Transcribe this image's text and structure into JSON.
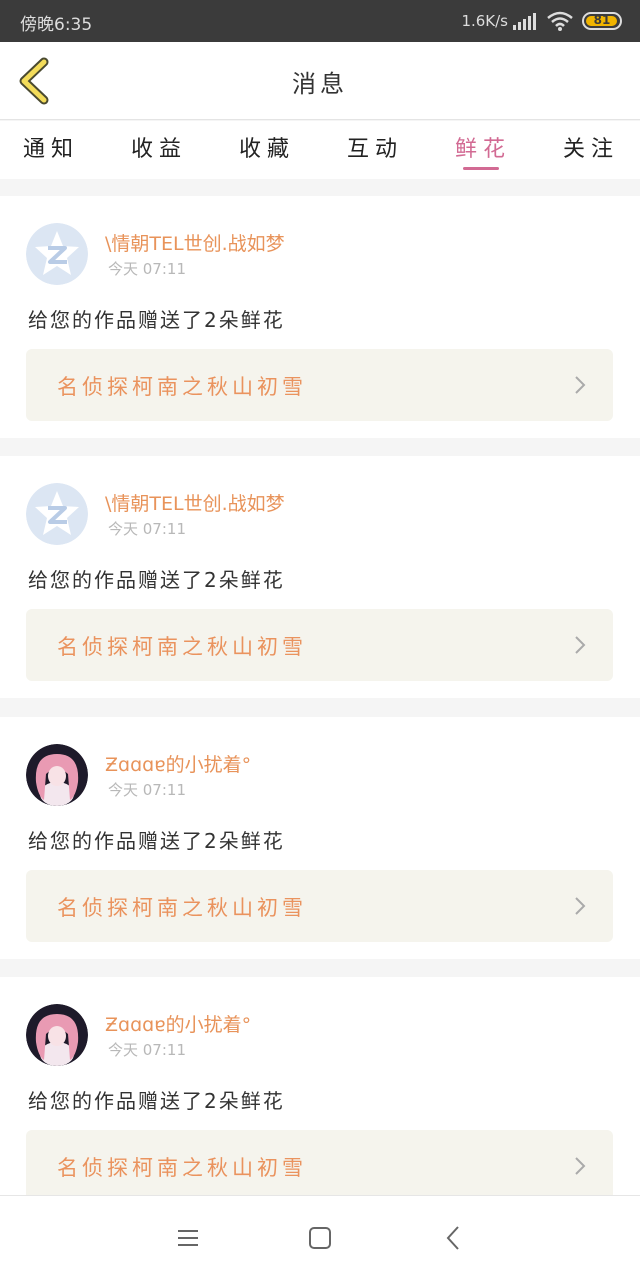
{
  "status": {
    "time": "傍晚6:35",
    "speed": "1.6K/s",
    "battery": "81"
  },
  "header": {
    "title": "消息"
  },
  "tabs": [
    {
      "label": "通知"
    },
    {
      "label": "收益"
    },
    {
      "label": "收藏"
    },
    {
      "label": "互动"
    },
    {
      "label": "鲜花",
      "active": true
    },
    {
      "label": "关注"
    }
  ],
  "messages": [
    {
      "user": "\\情朝TEL世创.战如梦",
      "time": "今天 07:11",
      "text": "给您的作品赠送了2朵鲜花",
      "work": "名侦探柯南之秋山初雪",
      "avatar": "default-qzone-icon"
    },
    {
      "user": "\\情朝TEL世创.战如梦",
      "time": "今天 07:11",
      "text": "给您的作品赠送了2朵鲜花",
      "work": "名侦探柯南之秋山初雪",
      "avatar": "default-qzone-icon"
    },
    {
      "user": "Ƶɑɑɑɐ的小扰着°",
      "time": "今天 07:11",
      "text": "给您的作品赠送了2朵鲜花",
      "work": "名侦探柯南之秋山初雪",
      "avatar": "anime-girl-avatar"
    },
    {
      "user": "Ƶɑɑɑɐ的小扰着°",
      "time": "今天 07:11",
      "text": "给您的作品赠送了2朵鲜花",
      "work": "名侦探柯南之秋山初雪",
      "avatar": "anime-girl-avatar"
    }
  ],
  "colors": {
    "accent": "#d26a93",
    "username": "#e8935a",
    "work_title": "#ea935e",
    "work_bg": "#f5f4ed"
  }
}
